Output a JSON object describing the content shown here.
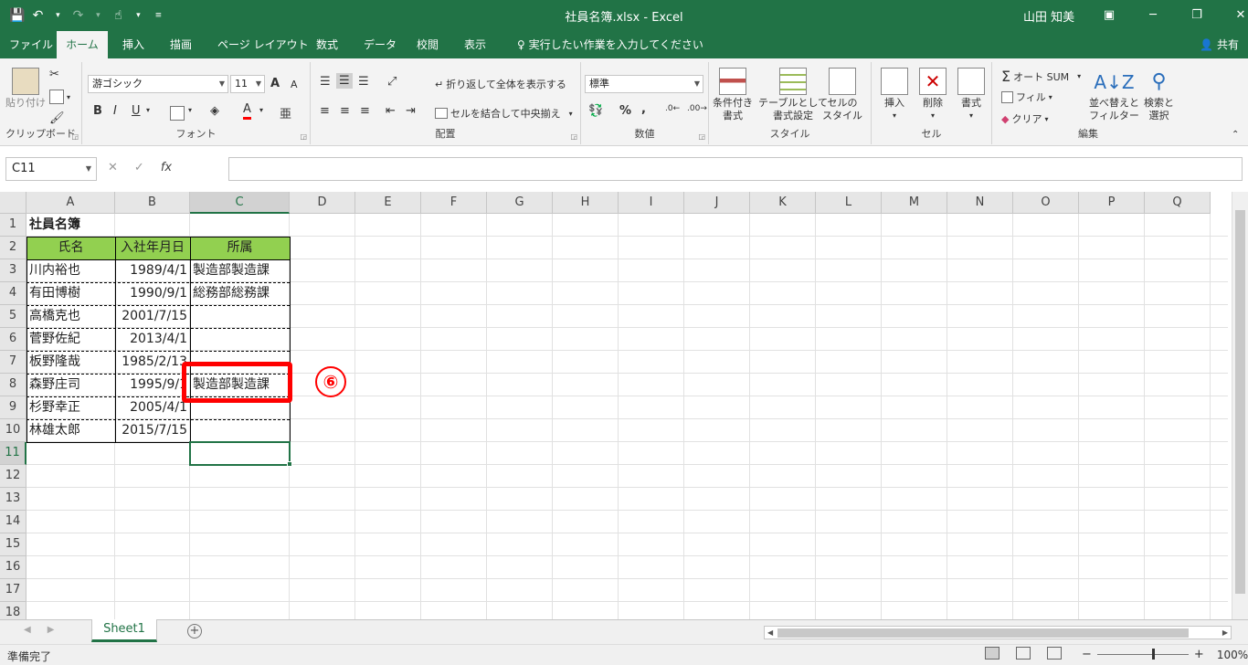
{
  "window": {
    "title": "社員名簿.xlsx  -  Excel",
    "user": "山田 知美",
    "minimize": "─",
    "restore": "❐",
    "close": "✕"
  },
  "qat": {
    "save": "💾",
    "undo": "↶",
    "redo": "↷",
    "touch": "☝",
    "dd": "▾",
    "customize": "≡"
  },
  "tabs": {
    "file": "ファイル",
    "home": "ホーム",
    "insert": "挿入",
    "draw": "描画",
    "layout": "ページ レイアウト",
    "formulas": "数式",
    "data": "データ",
    "review": "校閲",
    "view": "表示",
    "tellme": "実行したい作業を入力してください",
    "share": "共有"
  },
  "ribbon": {
    "clipboard": {
      "label": "クリップボード",
      "paste": "貼り付け"
    },
    "font": {
      "label": "フォント",
      "name": "游ゴシック",
      "size": "11",
      "bold": "B",
      "italic": "I",
      "underline": "U",
      "grow": "A",
      "shrink": "A",
      "color_a": "A",
      "phonetic": "亜"
    },
    "align": {
      "label": "配置",
      "wrap": "折り返して全体を表示する",
      "merge": "セルを結合して中央揃え"
    },
    "number": {
      "label": "数値",
      "format": "標準",
      "pct": "%",
      "comma": ","
    },
    "styles": {
      "label": "スタイル",
      "cond": "条件付き\n書式",
      "table": "テーブルとして\n書式設定",
      "cell": "セルの\nスタイル"
    },
    "cells": {
      "label": "セル",
      "insert": "挿入",
      "delete": "削除",
      "format": "書式"
    },
    "edit": {
      "label": "編集",
      "autosum": "オート SUM",
      "fill": "フィル",
      "clear": "クリア",
      "sort": "並べ替えと\nフィルター",
      "find": "検索と\n選択"
    }
  },
  "formula": {
    "namebox": "C11",
    "cancel": "✕",
    "enter": "✓",
    "fx": "fx",
    "value": ""
  },
  "columns": [
    "A",
    "B",
    "C",
    "D",
    "E",
    "F",
    "G",
    "H",
    "I",
    "J",
    "K",
    "L",
    "M",
    "N",
    "O",
    "P",
    "Q"
  ],
  "rows": [
    "1",
    "2",
    "3",
    "4",
    "5",
    "6",
    "7",
    "8",
    "9",
    "10",
    "11",
    "12",
    "13",
    "14",
    "15",
    "16",
    "17",
    "18"
  ],
  "sheet": {
    "title": "社員名簿",
    "headers": [
      "氏名",
      "入社年月日",
      "所属"
    ],
    "records": [
      [
        "川内裕也",
        "1989/4/1",
        "製造部製造課"
      ],
      [
        "有田博樹",
        "1990/9/1",
        "総務部総務課"
      ],
      [
        "高橋克也",
        "2001/7/15",
        ""
      ],
      [
        "菅野佐紀",
        "2013/4/1",
        ""
      ],
      [
        "板野隆哉",
        "1985/2/13",
        ""
      ],
      [
        "森野庄司",
        "1995/9/1",
        "製造部製造課"
      ],
      [
        "杉野幸正",
        "2005/4/1",
        ""
      ],
      [
        "林雄太郎",
        "2015/7/15",
        ""
      ]
    ]
  },
  "annotation": {
    "step": "⑥"
  },
  "sheettabs": {
    "active": "Sheet1",
    "add": "+"
  },
  "status": {
    "text": "準備完了",
    "zoom": "100%",
    "minus": "−",
    "plus": "+"
  },
  "colors": {
    "accent": "#217346",
    "header_fill": "#92d050",
    "highlight": "#ff0000"
  }
}
